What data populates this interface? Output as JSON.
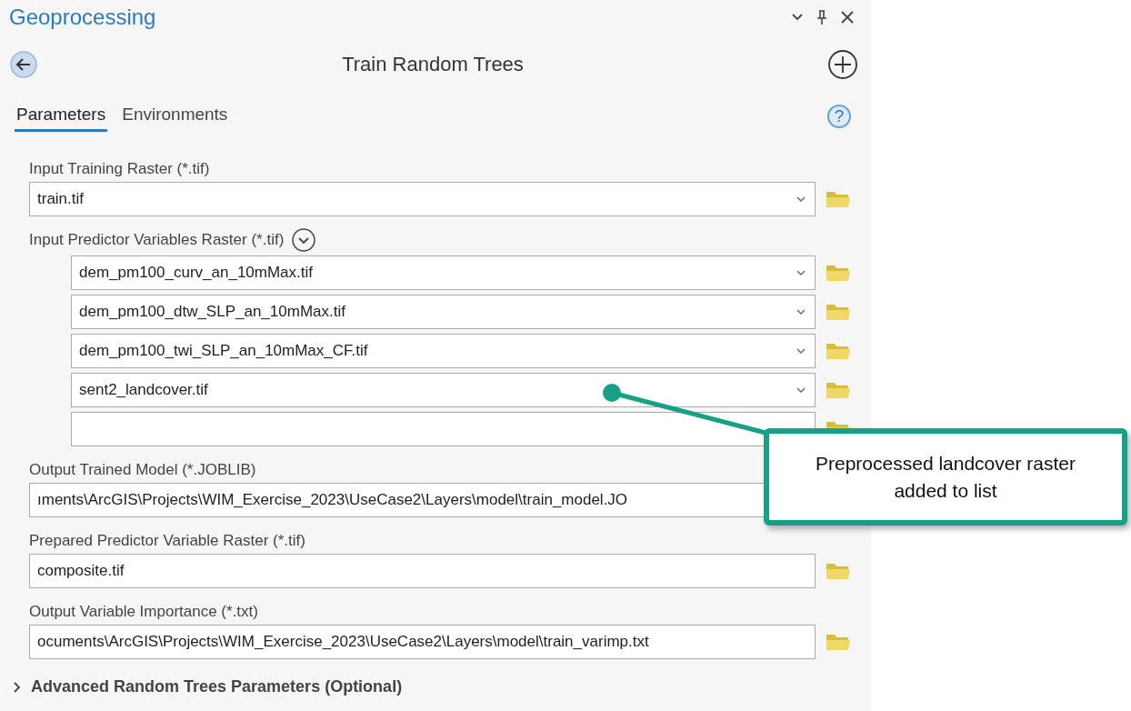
{
  "pane": {
    "title": "Geoprocessing"
  },
  "tool": {
    "title": "Train Random Trees"
  },
  "tabs": [
    {
      "label": "Parameters",
      "selected": true
    },
    {
      "label": "Environments",
      "selected": false
    }
  ],
  "help": {
    "glyph": "?"
  },
  "parameters": [
    {
      "label": "Input Training Raster (*.tif)",
      "kind": "dropdown",
      "value": "train.tif",
      "browse": true
    },
    {
      "label": "Input Predictor Variables Raster (*.tif)",
      "kind": "list",
      "expanded": true,
      "rows": [
        {
          "kind": "dropdown",
          "value": "dem_pm100_curv_an_10mMax.tif"
        },
        {
          "kind": "dropdown",
          "value": "dem_pm100_dtw_SLP_an_10mMax.tif"
        },
        {
          "kind": "dropdown",
          "value": "dem_pm100_twi_SLP_an_10mMax_CF.tif"
        },
        {
          "kind": "dropdown",
          "value": "sent2_landcover.tif"
        },
        {
          "kind": "empty"
        }
      ]
    },
    {
      "label": "Output Trained Model (*.JOBLIB)",
      "kind": "text",
      "value": "ıments\\ArcGIS\\Projects\\WIM_Exercise_2023\\UseCase2\\Layers\\model\\train_model.JO",
      "browse": false
    },
    {
      "label": "Prepared Predictor Variable Raster (*.tif)",
      "kind": "text",
      "value": "composite.tif",
      "browse": true
    },
    {
      "label": "Output Variable Importance (*.txt)",
      "kind": "text",
      "value": "ocuments\\ArcGIS\\Projects\\WIM_Exercise_2023\\UseCase2\\Layers\\model\\train_varimp.txt",
      "browse": true
    }
  ],
  "advanced": {
    "label": "Advanced Random Trees Parameters (Optional)",
    "expanded": false
  },
  "callout": {
    "text": "Preprocessed landcover raster added to list"
  }
}
